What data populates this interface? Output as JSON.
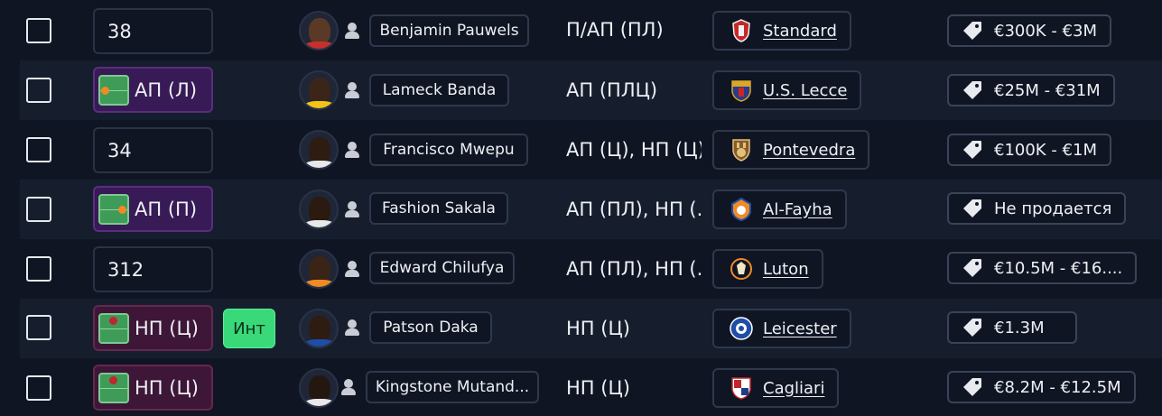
{
  "rows": [
    {
      "checked": false,
      "position_value": "38",
      "position_role": "",
      "int_badge": "",
      "name": "Benjamin Pauwels",
      "positions": "П/АП (ПЛ)",
      "club": "Standard",
      "value": "€300K - €3M"
    },
    {
      "checked": false,
      "position_value": "",
      "position_role": "АП (Л)",
      "int_badge": "",
      "name": "Lameck Banda",
      "positions": "АП (ПЛЦ)",
      "club": "U.S. Lecce",
      "value": "€25M - €31M"
    },
    {
      "checked": false,
      "position_value": "34",
      "position_role": "",
      "int_badge": "",
      "name": "Francisco Mwepu",
      "positions": "АП (Ц), НП (Ц)",
      "club": "Pontevedra",
      "value": "€100K - €1M"
    },
    {
      "checked": false,
      "position_value": "",
      "position_role": "АП (П)",
      "int_badge": "",
      "name": "Fashion Sakala",
      "positions": "АП (ПЛ), НП (...",
      "club": "Al-Fayha",
      "value": "Не продается"
    },
    {
      "checked": false,
      "position_value": "312",
      "position_role": "",
      "int_badge": "",
      "name": "Edward Chilufya",
      "positions": "АП (ПЛ), НП (...",
      "club": "Luton",
      "value": "€10.5M - €16...."
    },
    {
      "checked": false,
      "position_value": "",
      "position_role": "НП (Ц)",
      "int_badge": "Инт",
      "name": "Patson Daka",
      "positions": "НП (Ц)",
      "club": "Leicester",
      "value": "€1.3M"
    },
    {
      "checked": false,
      "position_value": "",
      "position_role": "НП (Ц)",
      "int_badge": "",
      "name": "Kingstone Mutand...",
      "positions": "НП (Ц)",
      "club": "Cagliari",
      "value": "€8.2M - €12.5M"
    }
  ],
  "colors": {
    "background": "#0f1523",
    "row_alt": "#161e2e",
    "role_purple": "#381a56",
    "role_forward": "#3e1738",
    "int_badge": "#39d97a",
    "pitch_green": "#3f9b58",
    "dot_orange": "#f08a24",
    "dot_red": "#c0262e"
  },
  "icons": {
    "checkbox": "checkbox-icon",
    "position_pitch": "pitch-icon",
    "personality": "person-icon",
    "price": "price-tag-icon",
    "club": "club-crest-icon"
  }
}
